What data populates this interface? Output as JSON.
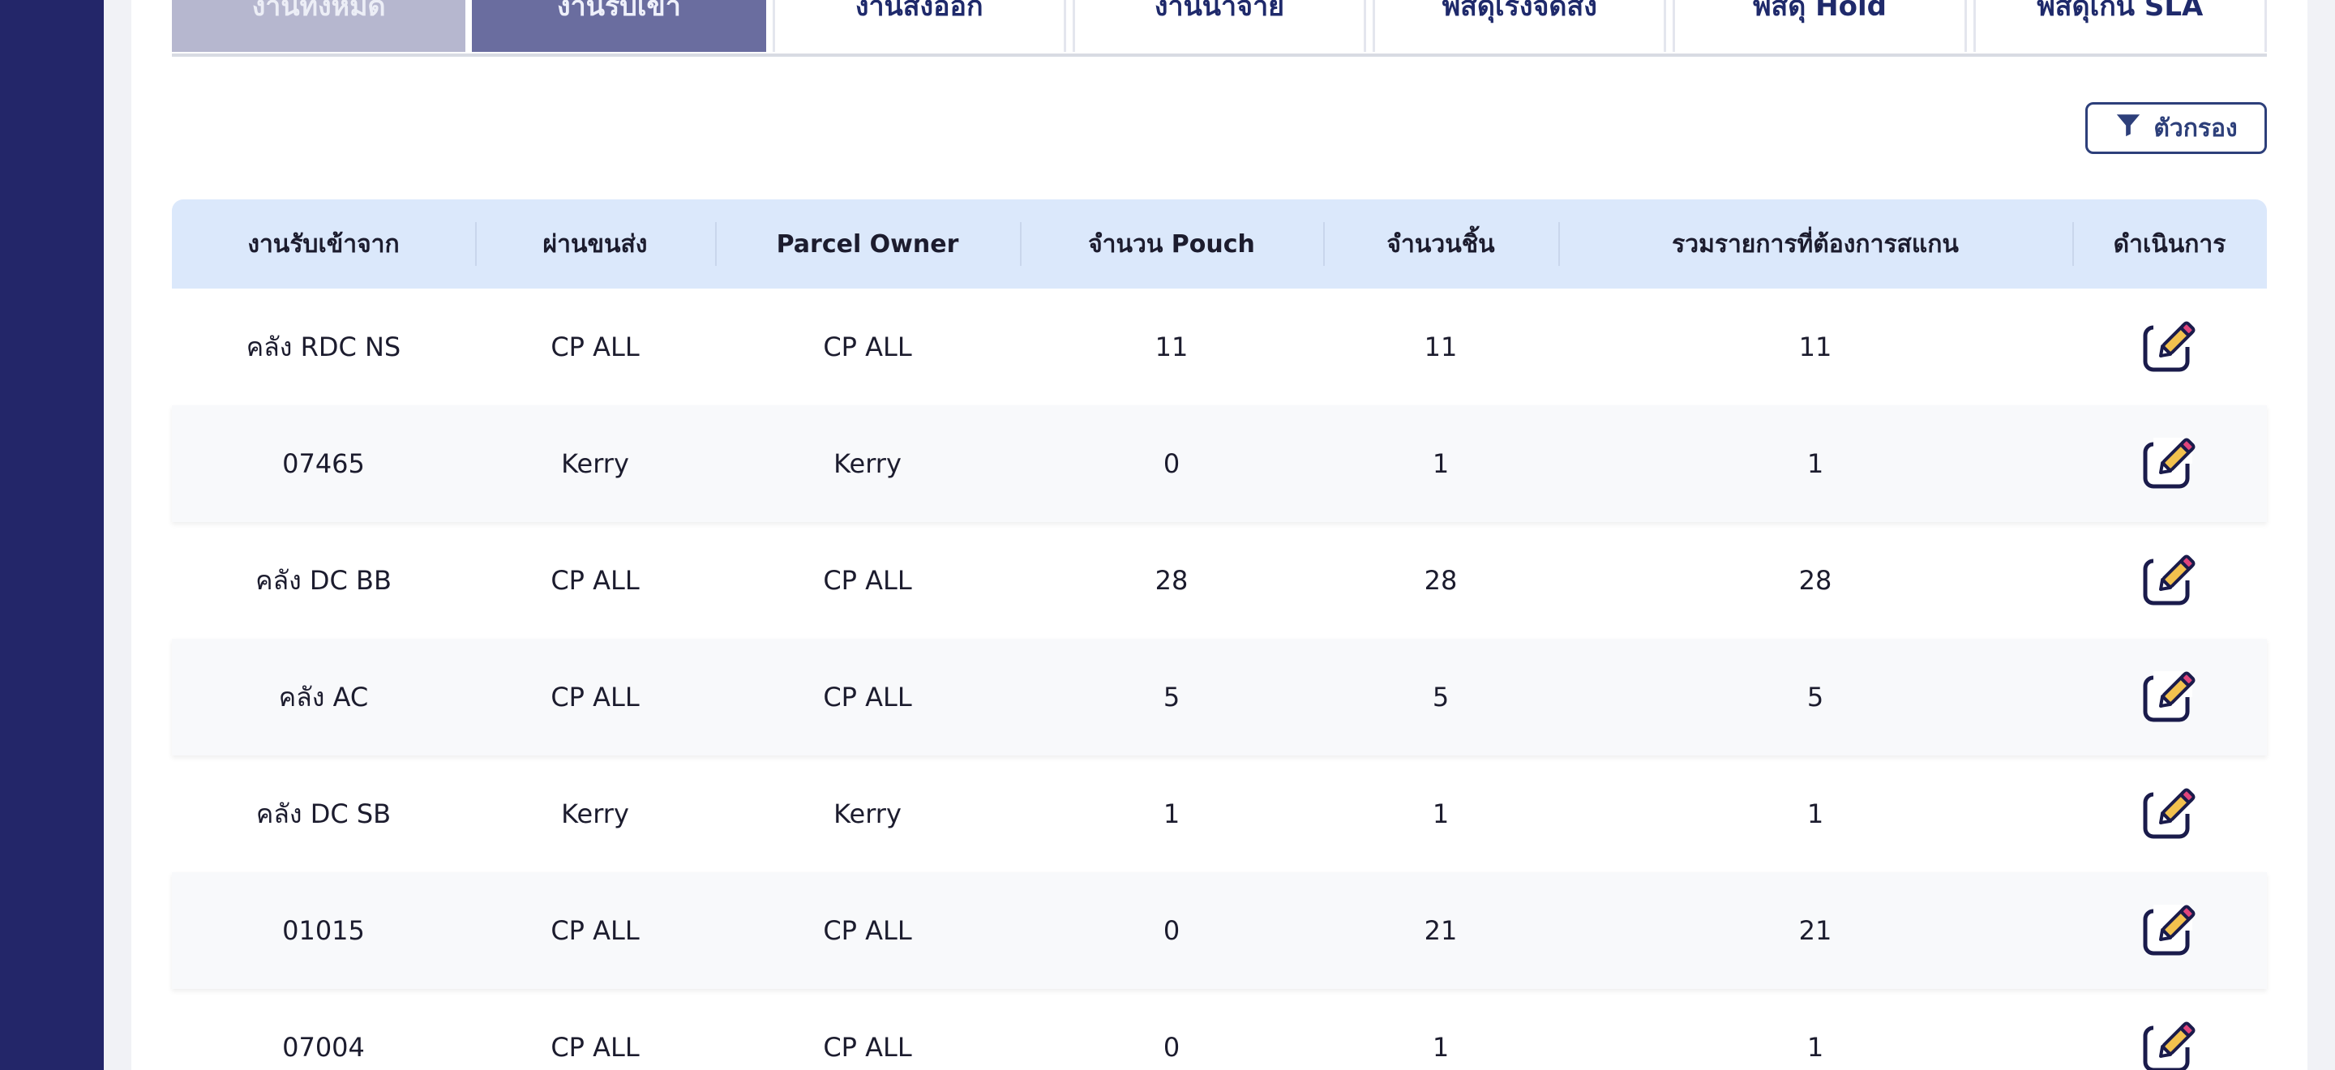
{
  "tabs": [
    {
      "label": "งานทั้งหมด"
    },
    {
      "label": "งานรับเข้า"
    },
    {
      "label": "งานส่งออก"
    },
    {
      "label": "งานนำจ่าย"
    },
    {
      "label": "พัสดุเร่งจัดส่ง"
    },
    {
      "label": "พัสดุ Hold"
    },
    {
      "label": "พัสดุเกิน SLA"
    }
  ],
  "filter": {
    "label": "ตัวกรอง",
    "icon": "filter-icon"
  },
  "table": {
    "headers": [
      "งานรับเข้าจาก",
      "ผ่านขนส่ง",
      "Parcel Owner",
      "จำนวน Pouch",
      "จำนวนชิ้น",
      "รวมรายการที่ต้องการสแกน",
      "ดำเนินการ"
    ],
    "rows": [
      {
        "from": "คลัง RDC NS",
        "carrier": "CP ALL",
        "owner": "CP ALL",
        "pouch": "11",
        "pieces": "11",
        "total": "11"
      },
      {
        "from": "07465",
        "carrier": "Kerry",
        "owner": "Kerry",
        "pouch": "0",
        "pieces": "1",
        "total": "1"
      },
      {
        "from": "คลัง DC BB",
        "carrier": "CP ALL",
        "owner": "CP ALL",
        "pouch": "28",
        "pieces": "28",
        "total": "28"
      },
      {
        "from": "คลัง AC",
        "carrier": "CP ALL",
        "owner": "CP ALL",
        "pouch": "5",
        "pieces": "5",
        "total": "5"
      },
      {
        "from": "คลัง DC SB",
        "carrier": "Kerry",
        "owner": "Kerry",
        "pouch": "1",
        "pieces": "1",
        "total": "1"
      },
      {
        "from": "01015",
        "carrier": "CP ALL",
        "owner": "CP ALL",
        "pouch": "0",
        "pieces": "21",
        "total": "21"
      },
      {
        "from": "07004",
        "carrier": "CP ALL",
        "owner": "CP ALL",
        "pouch": "0",
        "pieces": "1",
        "total": "1"
      }
    ]
  },
  "colors": {
    "sidebar": "#232669",
    "header_bg": "#dbe8fb",
    "tab_active": "#6a6d9f",
    "tab_dim": "#b6b7cf",
    "accent": "#2d3f7a",
    "edit_icon_pencil": "#f2c14e",
    "edit_icon_tip": "#e0457b"
  }
}
